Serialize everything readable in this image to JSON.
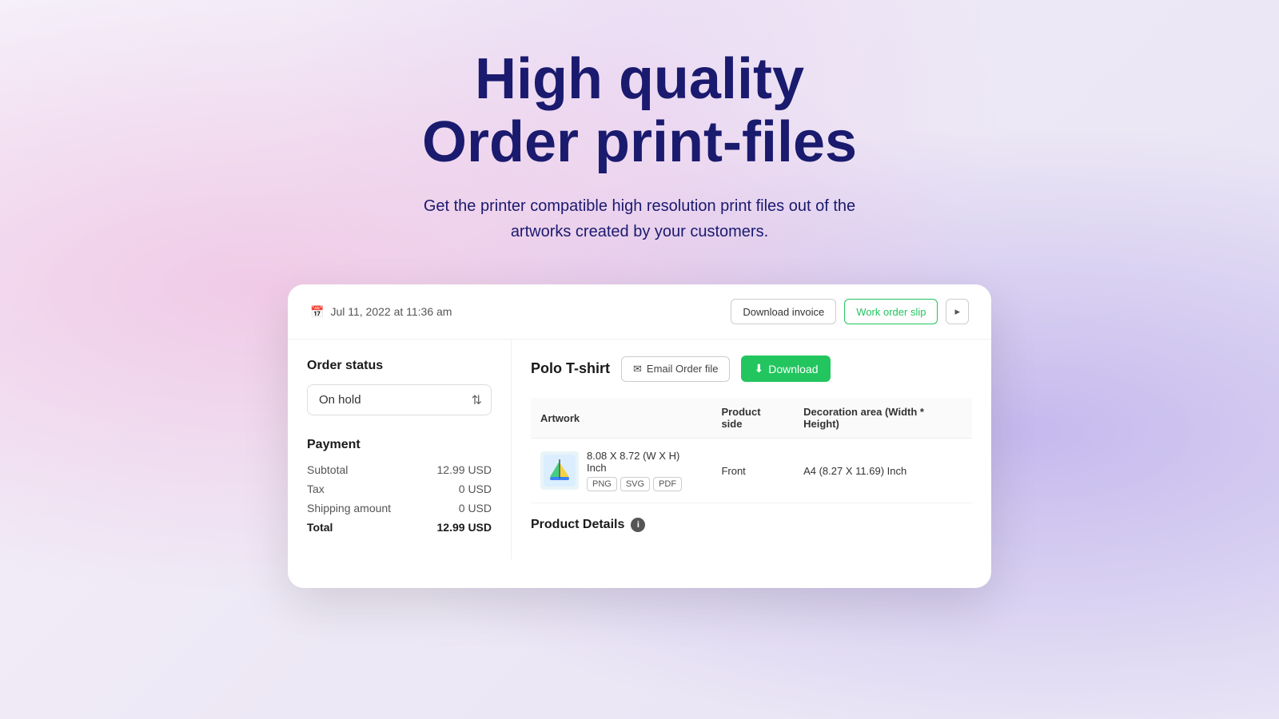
{
  "hero": {
    "title_line1": "High quality",
    "title_line2": "Order print-files",
    "subtitle_line1": "Get the printer compatible high resolution print files out of the",
    "subtitle_line2": "artworks created by your customers."
  },
  "card": {
    "date": "Jul 11, 2022 at 11:36 am",
    "buttons": {
      "download_invoice": "Download invoice",
      "work_order_slip": "Work order slip"
    },
    "order_status": {
      "label": "Order status",
      "value": "On hold"
    },
    "payment": {
      "label": "Payment",
      "subtotal_label": "Subtotal",
      "subtotal_value": "12.99 USD",
      "tax_label": "Tax",
      "tax_value": "0 USD",
      "shipping_label": "Shipping amount",
      "shipping_value": "0 USD",
      "total_label": "Total",
      "total_value": "12.99 USD"
    },
    "product": {
      "name": "Polo T-shirt",
      "email_btn": "Email Order file",
      "download_btn": "Download",
      "table": {
        "col1": "Artwork",
        "col2": "Product side",
        "col3": "Decoration area (Width * Height)",
        "row": {
          "size": "8.08 X 8.72 (W X H) Inch",
          "formats": [
            "PNG",
            "SVG",
            "PDF"
          ],
          "side": "Front",
          "area": "A4 (8.27 X 11.69) Inch"
        }
      },
      "details_label": "Product Details"
    }
  },
  "icons": {
    "calendar": "📅",
    "envelope": "✉",
    "download_arrow": "⬇",
    "info": "i"
  }
}
